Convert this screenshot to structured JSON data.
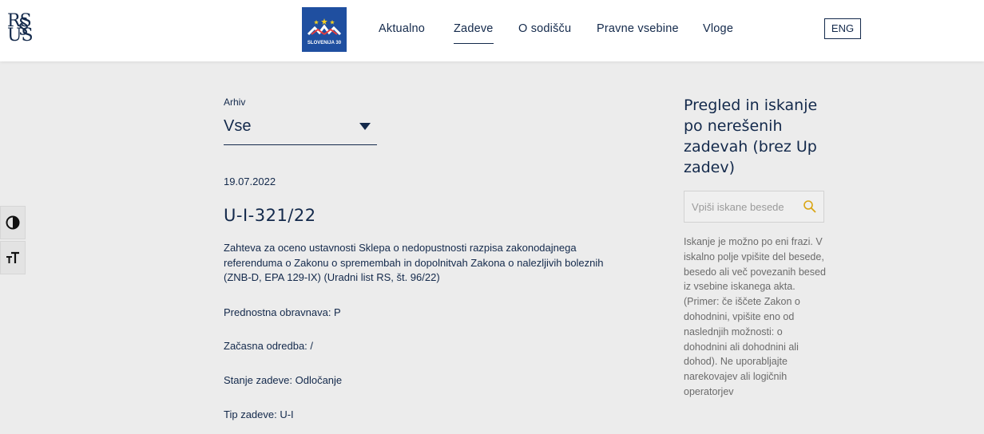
{
  "header": {
    "logo_line1": "RS",
    "logo_line2": "US",
    "logo_mark": "§",
    "badge_text": "SLOVENIJA 30",
    "nav": [
      {
        "label": "Aktualno"
      },
      {
        "label": "Zadeve",
        "active": true
      },
      {
        "label": "O sodišču"
      },
      {
        "label": "Pravne vsebine"
      },
      {
        "label": "Vloge"
      }
    ],
    "lang_label": "ENG"
  },
  "tools": {
    "contrast_icon": "contrast-icon",
    "text_size_icon": "text-size-icon"
  },
  "archive": {
    "label": "Arhiv",
    "value": "Vse"
  },
  "case": {
    "date": "19.07.2022",
    "title": "U-I-321/22",
    "description": "Zahteva za oceno ustavnosti Sklepa o nedopustnosti razpisa zakonodajnega referenduma o Zakonu o spremembah in dopolnitvah Zakona o nalezljivih boleznih (ZNB-D, EPA 129-IX) (Uradni list RS, št. 96/22)",
    "priority": "Prednostna obravnava: P",
    "interim": "Začasna odredba: /",
    "status": "Stanje zadeve: Odločanje",
    "type": "Tip zadeve: U-I"
  },
  "sidebar": {
    "heading": "Pregled in iskanje po nerešenih zadevah (brez Up zadev)",
    "search_placeholder": "Vpiši iskane besede",
    "search_value": "",
    "help_text": "Iskanje je možno po eni frazi. V iskalno polje vpišite del besede, besedo ali več povezanih besed iz vsebine iskanega akta. (Primer: če iščete Zakon o dohodnini, vpišite eno od naslednjih možnosti: o dohodnini ali dohodnini ali dohod). Ne uporabljajte narekovajev ali logičnih operatorjev",
    "accent_color": "#d9a514"
  }
}
